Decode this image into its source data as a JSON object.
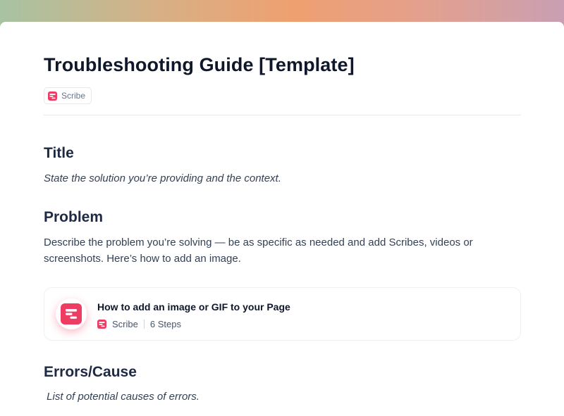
{
  "document": {
    "title": "Troubleshooting Guide [Template]",
    "author_chip": {
      "label": "Scribe",
      "icon": "scribe-logo-icon"
    }
  },
  "sections": [
    {
      "heading": "Title",
      "text": "State the solution you’re providing and the context."
    },
    {
      "heading": "Problem",
      "text": "Describe the problem you’re solving — be as specific as needed and add Scribes, videos or screenshots. Here’s how to add an image."
    },
    {
      "heading": "Errors/Cause",
      "text": " List of potential causes of errors."
    }
  ],
  "embed": {
    "title": "How to add an image or GIF to your Page",
    "author": "Scribe",
    "steps": "6 Steps",
    "icon": "scribe-logo-icon"
  },
  "colors": {
    "brand": "#ee3d62",
    "heading": "#1e2a44",
    "body": "#334155"
  }
}
